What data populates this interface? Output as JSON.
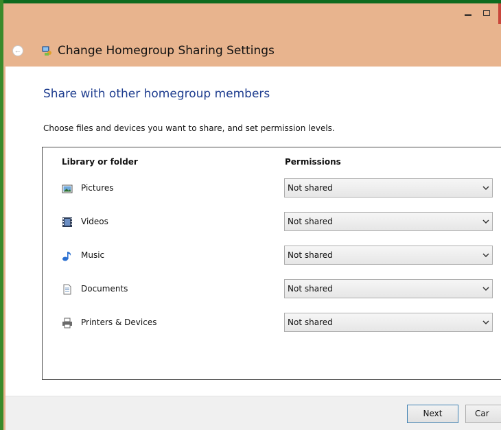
{
  "window": {
    "title": "Change Homegroup Sharing Settings"
  },
  "main": {
    "heading": "Share with other homegroup members",
    "description": "Choose files and devices you want to share, and set permission levels.",
    "columns": {
      "library": "Library or folder",
      "permissions": "Permissions"
    },
    "rows": [
      {
        "label": "Pictures",
        "icon": "pictures-icon",
        "permission": "Not shared"
      },
      {
        "label": "Videos",
        "icon": "videos-icon",
        "permission": "Not shared"
      },
      {
        "label": "Music",
        "icon": "music-icon",
        "permission": "Not shared"
      },
      {
        "label": "Documents",
        "icon": "documents-icon",
        "permission": "Not shared"
      },
      {
        "label": "Printers & Devices",
        "icon": "printer-icon",
        "permission": "Not shared"
      }
    ]
  },
  "footer": {
    "next_label": "Next",
    "cancel_label": "Car"
  },
  "colors": {
    "titlebar": "#e8b48e",
    "heading": "#1e3d8f",
    "desktop": "#1f7a1f"
  }
}
